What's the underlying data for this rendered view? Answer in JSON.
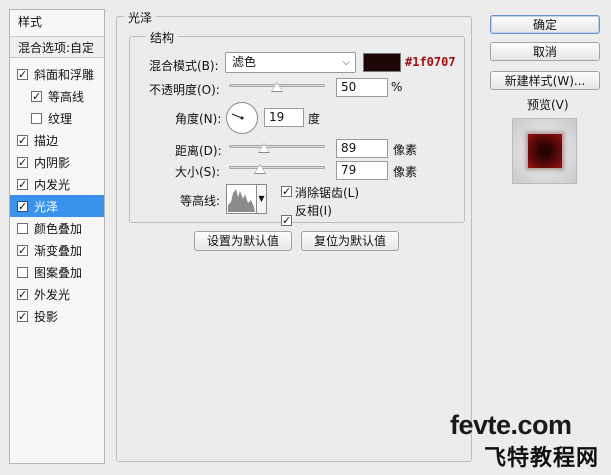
{
  "styles_panel": {
    "header": "样式",
    "blend_options": "混合选项:自定",
    "items": [
      {
        "label": "斜面和浮雕",
        "checked": true,
        "sub": false,
        "selected": false
      },
      {
        "label": "等高线",
        "checked": true,
        "sub": true,
        "selected": false
      },
      {
        "label": "纹理",
        "checked": false,
        "sub": true,
        "selected": false
      },
      {
        "label": "描边",
        "checked": true,
        "sub": false,
        "selected": false
      },
      {
        "label": "内阴影",
        "checked": true,
        "sub": false,
        "selected": false
      },
      {
        "label": "内发光",
        "checked": true,
        "sub": false,
        "selected": false
      },
      {
        "label": "光泽",
        "checked": true,
        "sub": false,
        "selected": true
      },
      {
        "label": "颜色叠加",
        "checked": false,
        "sub": false,
        "selected": false
      },
      {
        "label": "渐变叠加",
        "checked": true,
        "sub": false,
        "selected": false
      },
      {
        "label": "图案叠加",
        "checked": false,
        "sub": false,
        "selected": false
      },
      {
        "label": "外发光",
        "checked": true,
        "sub": false,
        "selected": false
      },
      {
        "label": "投影",
        "checked": true,
        "sub": false,
        "selected": false
      }
    ]
  },
  "satin": {
    "title": "光泽",
    "structure_title": "结构",
    "blend_mode_label": "混合模式(B):",
    "blend_mode_value": "滤色",
    "color_hex": "#1f0707",
    "opacity_label": "不透明度(O):",
    "opacity_value": "50",
    "opacity_unit": "%",
    "angle_label": "角度(N):",
    "angle_value": "19",
    "angle_unit": "度",
    "distance_label": "距离(D):",
    "distance_value": "89",
    "distance_unit": "像素",
    "size_label": "大小(S):",
    "size_value": "79",
    "size_unit": "像素",
    "contour_label": "等高线:",
    "antialias_label": "消除锯齿(L)",
    "antialias_checked": true,
    "invert_label": "反相(I)",
    "invert_checked": true,
    "make_default": "设置为默认值",
    "reset_default": "复位为默认值",
    "opacity_level": 0.5,
    "distance_level": 0.36,
    "size_level": 0.32
  },
  "buttons": {
    "ok": "确定",
    "cancel": "取消",
    "new_style": "新建样式(W)...",
    "preview_label": "预览(V)",
    "preview_checked": true
  },
  "watermark": {
    "line1": "fevte.com",
    "line2": "飞特教程网"
  }
}
